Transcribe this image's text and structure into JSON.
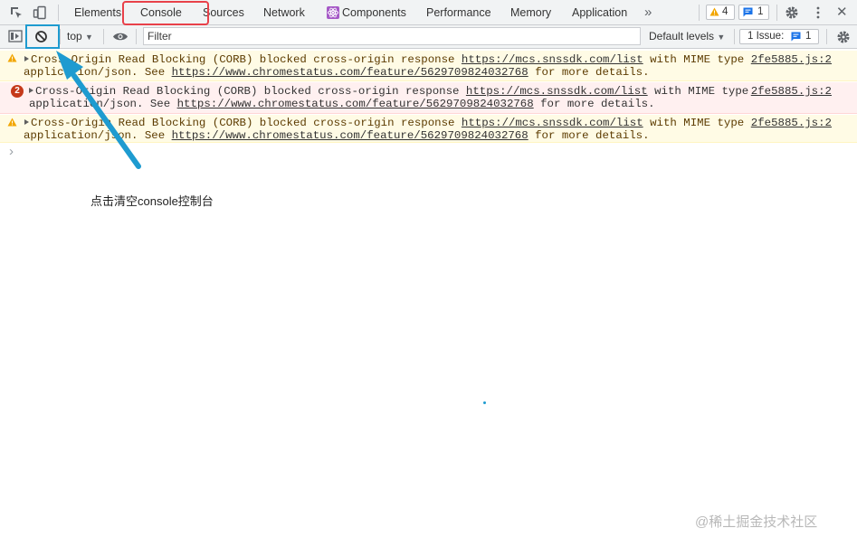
{
  "devtools": {
    "tabs": [
      {
        "label": "Elements"
      },
      {
        "label": "Console"
      },
      {
        "label": "Sources"
      },
      {
        "label": "Network"
      },
      {
        "label": "Components"
      },
      {
        "label": "Performance"
      },
      {
        "label": "Memory"
      },
      {
        "label": "Application"
      }
    ],
    "more_tabs": "»",
    "warnings_count": "4",
    "messages_count": "1",
    "close_glyph": "✕"
  },
  "console_toolbar": {
    "context": "top",
    "filter_placeholder": "Filter",
    "levels_label": "Default levels",
    "issues_label": "1 Issue:",
    "issues_count": "1"
  },
  "messages": [
    {
      "level": "warning",
      "text_part1": "Cross-Origin Read Blocking (CORB) blocked cross-origin response ",
      "link1": "https://mcs.snssdk.com/list",
      "text_part2": " with MIME type",
      "text_part3": "application/json. See ",
      "link2": "https://www.chromestatus.com/feature/5629709824032768",
      "text_part4": " for more details.",
      "source": "2fe5885.js:2"
    },
    {
      "level": "error",
      "repeat_count": "2",
      "text_part1": "Cross-Origin Read Blocking (CORB) blocked cross-origin response ",
      "link1": "https://mcs.snssdk.com/list",
      "text_part2": " with MIME type",
      "text_part3": "application/json. See ",
      "link2": "https://www.chromestatus.com/feature/5629709824032768",
      "text_part4": " for more details.",
      "source": "2fe5885.js:2"
    },
    {
      "level": "warning",
      "text_part1": "Cross-Origin Read Blocking (CORB) blocked cross-origin response ",
      "link1": "https://mcs.snssdk.com/list",
      "text_part2": " with MIME type",
      "text_part3": "application/json. See ",
      "link2": "https://www.chromestatus.com/feature/5629709824032768",
      "text_part4": " for more details.",
      "source": "2fe5885.js:2"
    }
  ],
  "prompt_glyph": "›",
  "annotation": {
    "text": "点击清空console控制台",
    "highlight_color": "#e8414a",
    "arrow_color": "#1e9bd0"
  },
  "watermark": "@稀土掘金技术社区",
  "colors": {
    "toolbar_bg": "#f1f3f4",
    "warning_bg": "#fffbe5",
    "error_bg": "#fff0f0",
    "error_badge": "#c5391a",
    "warning_icon": "#f2a600",
    "message_icon": "#1a73e8"
  }
}
